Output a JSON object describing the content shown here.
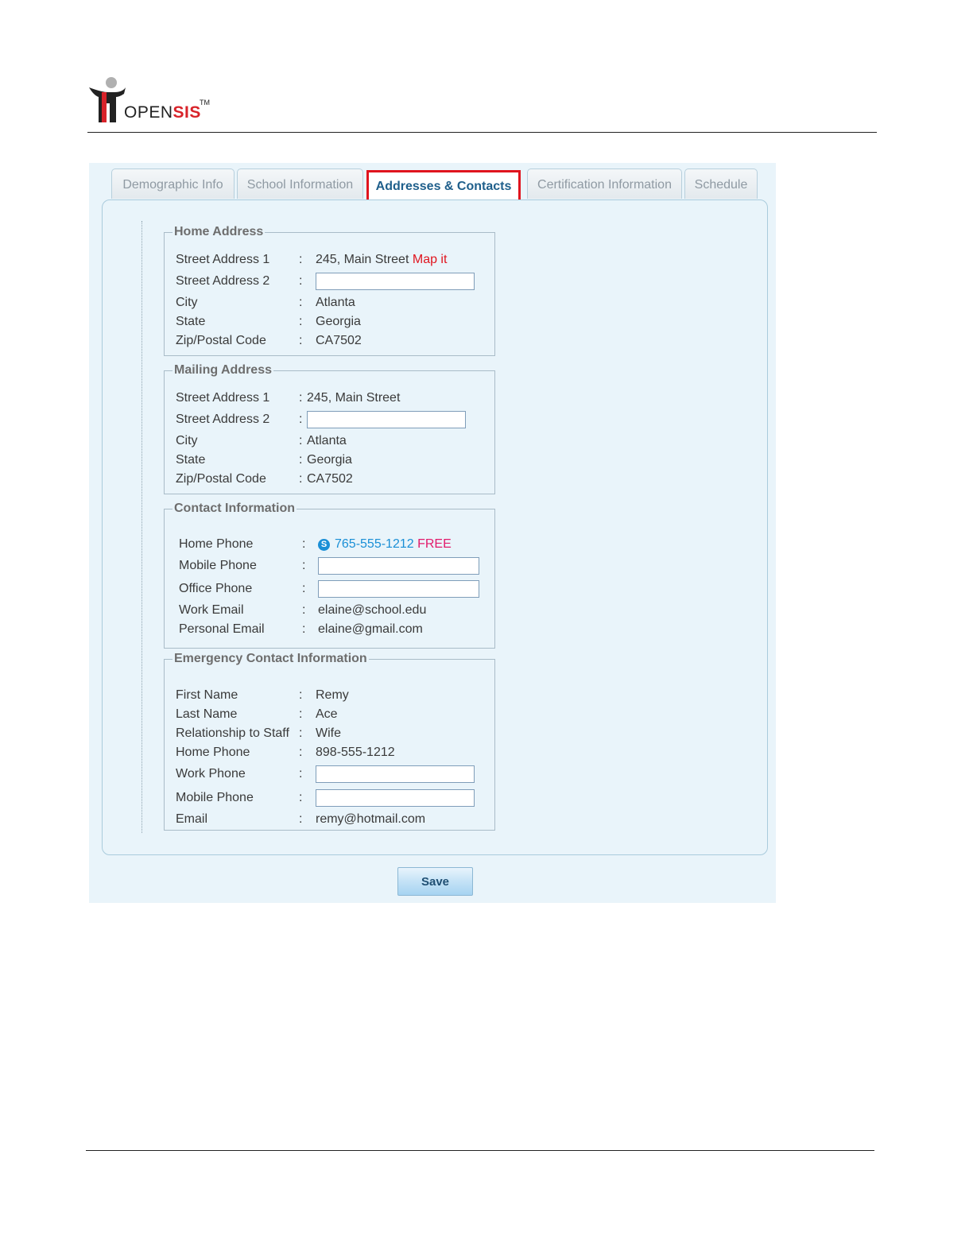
{
  "logo": {
    "text_open": "OPEN",
    "text_sis": "SIS",
    "tm": "TM"
  },
  "tabs": [
    {
      "label": "Demographic Info"
    },
    {
      "label": "School Information"
    },
    {
      "label": "Addresses & Contacts"
    },
    {
      "label": "Certification Information"
    },
    {
      "label": "Schedule"
    }
  ],
  "home_address": {
    "legend": "Home Address",
    "street1_label": "Street Address 1",
    "street1_value": "245, Main Street",
    "map_link": "Map it",
    "street2_label": "Street Address 2",
    "city_label": "City",
    "city_value": "Atlanta",
    "state_label": "State",
    "state_value": "Georgia",
    "zip_label": "Zip/Postal Code",
    "zip_value": "CA7502"
  },
  "mailing_address": {
    "legend": "Mailing Address",
    "street1_label": "Street Address 1",
    "street1_value": "245, Main Street",
    "street2_label": "Street Address 2",
    "city_label": "City",
    "city_value": "Atlanta",
    "state_label": "State",
    "state_value": "Georgia",
    "zip_label": "Zip/Postal Code",
    "zip_value": "CA7502"
  },
  "contact_info": {
    "legend": "Contact Information",
    "home_phone_label": "Home Phone",
    "home_phone_value": "765-555-1212",
    "free_label": "FREE",
    "mobile_phone_label": "Mobile Phone",
    "office_phone_label": "Office Phone",
    "work_email_label": "Work Email",
    "work_email_value": "elaine@school.edu",
    "personal_email_label": "Personal Email",
    "personal_email_value": "elaine@gmail.com"
  },
  "emergency": {
    "legend": "Emergency Contact Information",
    "first_name_label": "First Name",
    "first_name_value": "Remy",
    "last_name_label": "Last Name",
    "last_name_value": "Ace",
    "relationship_label": "Relationship to Staff",
    "relationship_value": "Wife",
    "home_phone_label": "Home Phone",
    "home_phone_value": "898-555-1212",
    "work_phone_label": "Work Phone",
    "mobile_phone_label": "Mobile Phone",
    "email_label": "Email",
    "email_value": "remy@hotmail.com"
  },
  "colon": ":",
  "save_label": "Save",
  "colors": {
    "accent_red": "#e0141e",
    "link_blue": "#1a8fd6",
    "panel_bg": "#e9f4fa"
  }
}
